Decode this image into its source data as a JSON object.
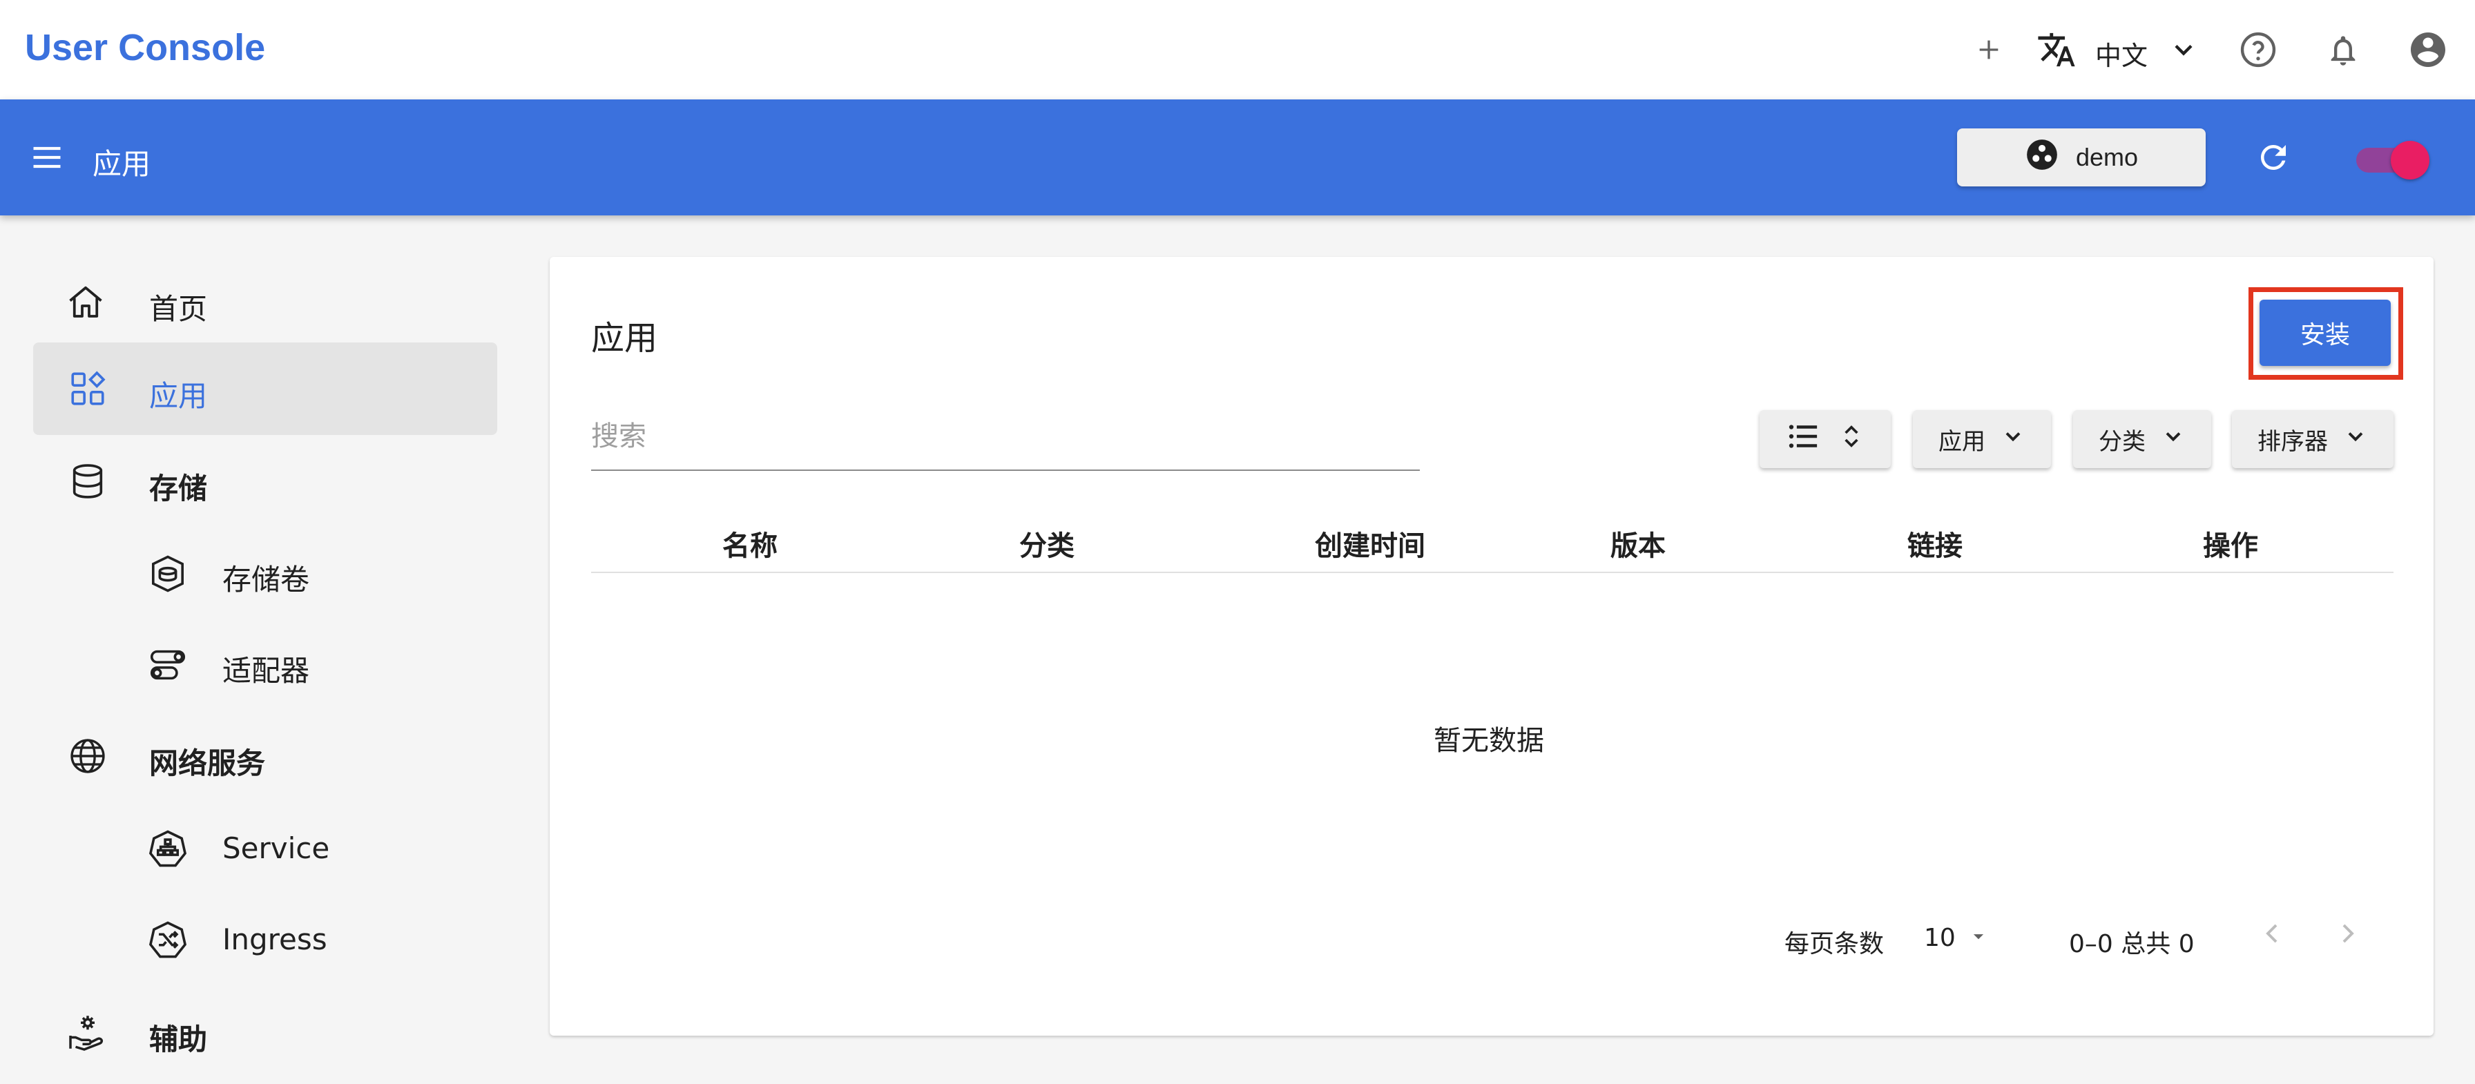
{
  "brand": "User Console",
  "topbar": {
    "language": "中文",
    "icons": [
      "add-icon",
      "translate-icon",
      "chevron-down-icon",
      "help-icon",
      "bell-icon",
      "account-icon"
    ]
  },
  "appbar": {
    "title": "应用",
    "namespace": "demo",
    "toggle_on": true
  },
  "sidebar": {
    "items": [
      {
        "label": "首页",
        "icon": "home-icon"
      },
      {
        "label": "应用",
        "icon": "apps-icon",
        "active": true
      },
      {
        "label": "存储",
        "icon": "database-icon"
      },
      {
        "label": "存储卷",
        "icon": "volume-icon",
        "child": true
      },
      {
        "label": "适配器",
        "icon": "adapter-icon",
        "child": true
      },
      {
        "label": "网络服务",
        "icon": "globe-icon"
      },
      {
        "label": "Service",
        "icon": "service-icon",
        "child": true
      },
      {
        "label": "Ingress",
        "icon": "ingress-icon",
        "child": true
      },
      {
        "label": "辅助",
        "icon": "helper-icon"
      }
    ]
  },
  "main": {
    "title": "应用",
    "install_label": "安装",
    "search_placeholder": "搜索",
    "filters": {
      "app_label": "应用",
      "category_label": "分类",
      "sorter_label": "排序器"
    },
    "columns": [
      "名称",
      "分类",
      "创建时间",
      "版本",
      "链接",
      "操作"
    ],
    "empty_text": "暂无数据",
    "pager": {
      "rows_per_page_label": "每页条数",
      "rows_per_page": "10",
      "range": "0–0 总共 0"
    }
  },
  "colors": {
    "primary": "#3b71dd",
    "highlight": "#e2361f",
    "toggle": "#e91e63"
  }
}
